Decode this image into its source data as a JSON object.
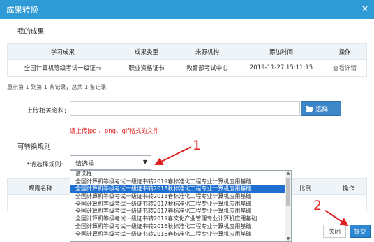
{
  "dialog": {
    "title": "成果转换",
    "close_glyph": "×"
  },
  "my_results": {
    "heading": "我的成果",
    "columns": [
      "学习成果",
      "成果类型",
      "来源机构",
      "添加时间",
      "操作"
    ],
    "rows": [
      {
        "name": "全国计算机等级考试一级证书",
        "type": "职业资格证书",
        "source": "教育部考试中心",
        "time": "2019-11-27 15:11:15",
        "action": "查看详情"
      }
    ],
    "summary": "显示第 1 到第 1 条记录，总共 1 条记录"
  },
  "upload": {
    "label": "上传相关资料:",
    "value": "",
    "button_label": "选择 ...",
    "hint": "请上传jpg 、png、gif格式的文件"
  },
  "rules": {
    "heading": "可转换规则",
    "select_label": "*请选择规则:",
    "select_value": "请选择",
    "columns": [
      "规则名称",
      "比例",
      "操作"
    ],
    "options": [
      "请选择",
      "全国计算机等级考试一级证书转2019春标准化工程专业计算机应用基础",
      "全国计算机等级考试一级证书转2018秋标准化工程专业计算机应用基础",
      "全国计算机等级考试一级证书转2018春标准化工程专业计算机应用基础",
      "全国计算机等级考试一级证书转2017秋标准化工程专业计算机应用基础",
      "全国计算机等级考试一级证书转2017春标准化工程专业计算机应用基础",
      "全国计算机等级考试一级证书转2019春文化产业管理专业计算机应用基础",
      "全国计算机等级考试一级证书转2016秋标准化工程专业计算机应用基础",
      "全国计算机等级考试一级证书转2016春标准化工程专业计算机应用基础"
    ],
    "selected_index": 2
  },
  "footer": {
    "close_label": "关闭",
    "submit_label": "提交"
  },
  "annotations": {
    "marker1": "1",
    "marker2": "2",
    "color": "#e02020"
  }
}
